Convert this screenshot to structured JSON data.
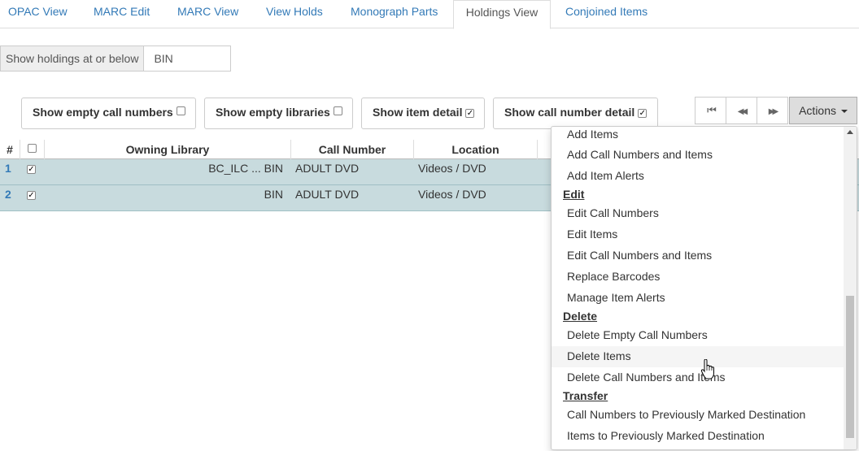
{
  "tabs": [
    "OPAC View",
    "MARC Edit",
    "MARC View",
    "View Holds",
    "Monograph Parts",
    "Holdings View",
    "Conjoined Items"
  ],
  "org_selector": {
    "label": "Show holdings at or below",
    "value": "BIN"
  },
  "toggles": {
    "empty_call_numbers": {
      "label": "Show empty call numbers",
      "checked": false
    },
    "empty_libraries": {
      "label": "Show empty libraries",
      "checked": false
    },
    "item_detail": {
      "label": "Show item detail",
      "checked": true
    },
    "call_number_detail": {
      "label": "Show call number detail",
      "checked": true
    }
  },
  "pager": {
    "first": "⏮",
    "prev": "◀◀",
    "next": "▶▶"
  },
  "actions": {
    "label": "Actions"
  },
  "grid": {
    "headers": {
      "num": "#",
      "owning_library": "Owning Library",
      "call_number": "Call Number",
      "location": "Location"
    },
    "rows": [
      {
        "num": "1",
        "owning_library": "BC_ILC ... BIN",
        "call_number": "ADULT DVD",
        "location": "Videos / DVD"
      },
      {
        "num": "2",
        "owning_library": "BIN",
        "call_number": "ADULT DVD",
        "location": "Videos / DVD"
      }
    ]
  },
  "menu": {
    "add_items": "Add Items",
    "add_call_numbers_and_items": "Add Call Numbers and Items",
    "add_item_alerts": "Add Item Alerts",
    "edit_header": "Edit",
    "edit_call_numbers": "Edit Call Numbers",
    "edit_items": "Edit Items",
    "edit_call_numbers_and_items": "Edit Call Numbers and Items",
    "replace_barcodes": "Replace Barcodes",
    "manage_item_alerts": "Manage Item Alerts",
    "delete_header": "Delete",
    "delete_empty_call_numbers": "Delete Empty Call Numbers",
    "delete_items": "Delete Items",
    "delete_call_numbers_and_items": "Delete Call Numbers and Items",
    "transfer_header": "Transfer",
    "call_numbers_to_marked": "Call Numbers to Previously Marked Destination",
    "items_to_marked": "Items to Previously Marked Destination"
  }
}
